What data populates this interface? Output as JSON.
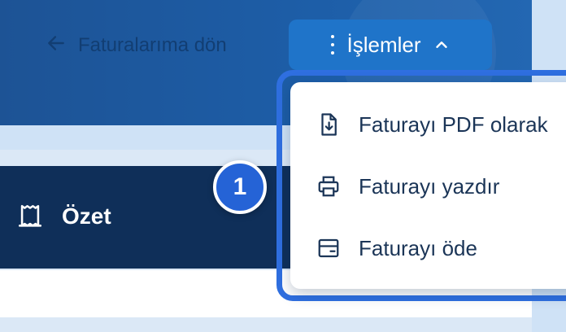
{
  "header": {
    "back_link": {
      "label": "Faturalarıma dön",
      "icon": "arrow-left-icon"
    },
    "actions_button": {
      "label": "İşlemler",
      "menu_icon": "kebab-icon",
      "state_icon": "chevron-up-icon"
    }
  },
  "summary": {
    "title": "Özet",
    "icon": "receipt-icon"
  },
  "step_badge": {
    "number": "1"
  },
  "actions_menu": {
    "items": [
      {
        "label": "Faturayı PDF olarak",
        "icon": "download-document-icon"
      },
      {
        "label": "Faturayı yazdır",
        "icon": "printer-icon"
      },
      {
        "label": "Faturayı öde",
        "icon": "card-icon"
      }
    ]
  },
  "colors": {
    "header": "#1d5ea8",
    "accent": "#1f74c9",
    "summary_bar": "#0f2f59",
    "highlight": "#2f6fe0",
    "text_dark": "#1b3557"
  }
}
